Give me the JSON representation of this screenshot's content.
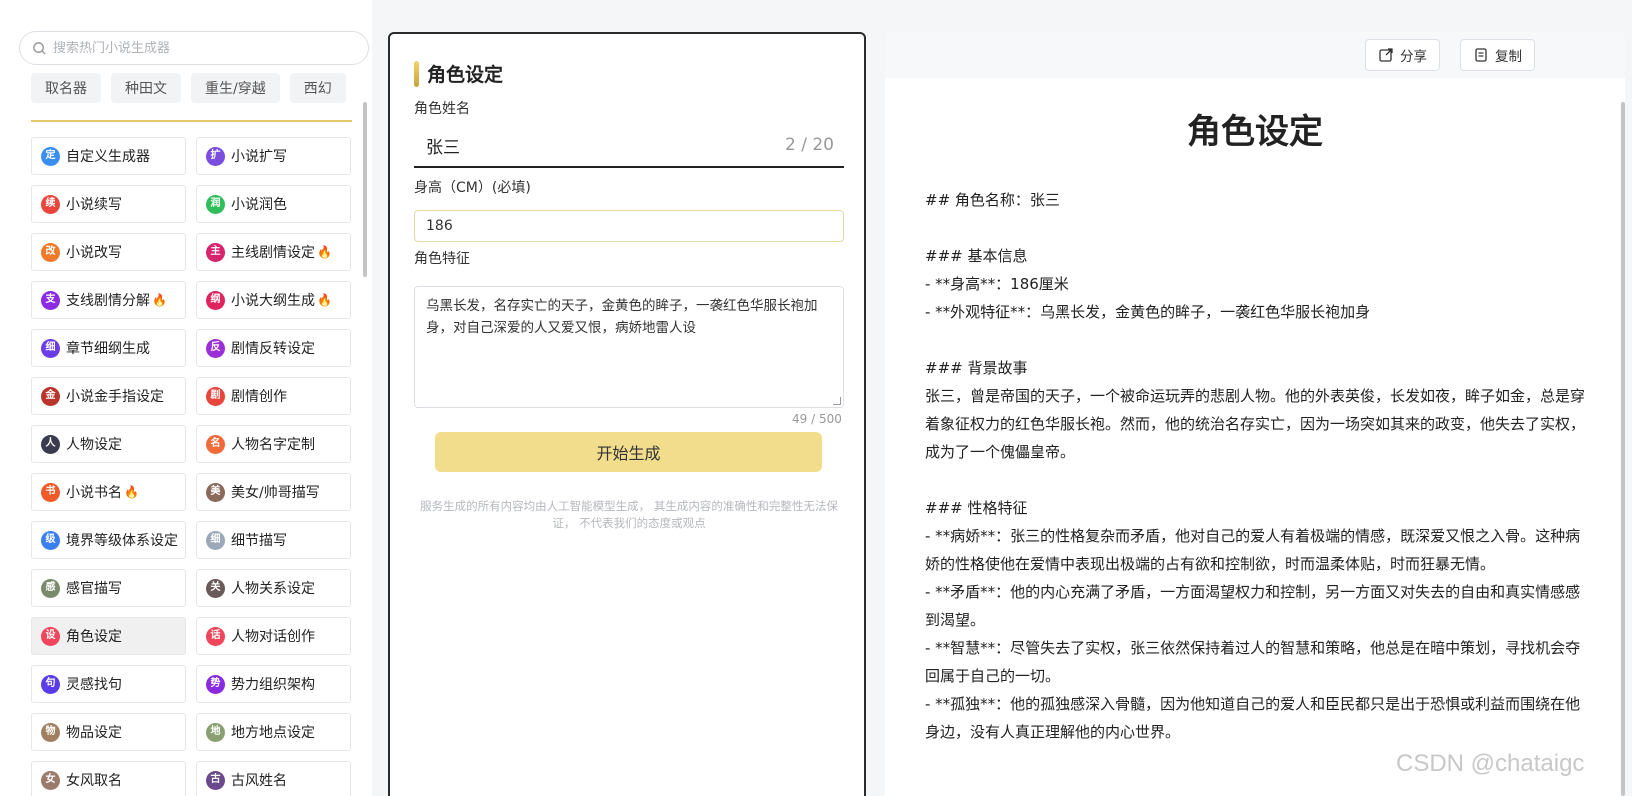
{
  "search": {
    "placeholder": "搜索热门小说生成器"
  },
  "categories": [
    "取名器",
    "种田文",
    "重生/穿越",
    "西幻"
  ],
  "tools": [
    {
      "label": "自定义生成器",
      "icon": "定",
      "color": "#3a8ef0",
      "hot": false,
      "active": false
    },
    {
      "label": "小说扩写",
      "icon": "扩",
      "color": "#7a4fe0",
      "hot": false,
      "active": false
    },
    {
      "label": "小说续写",
      "icon": "续",
      "color": "#e8453c",
      "hot": false,
      "active": false
    },
    {
      "label": "小说润色",
      "icon": "润",
      "color": "#2fbf5a",
      "hot": false,
      "active": false
    },
    {
      "label": "小说改写",
      "icon": "改",
      "color": "#f07a2a",
      "hot": false,
      "active": false
    },
    {
      "label": "主线剧情设定",
      "icon": "主",
      "color": "#d6246e",
      "hot": true,
      "active": false
    },
    {
      "label": "支线剧情分解",
      "icon": "支",
      "color": "#8a2be2",
      "hot": true,
      "active": false
    },
    {
      "label": "小说大纲生成",
      "icon": "纲",
      "color": "#e0245e",
      "hot": true,
      "active": false
    },
    {
      "label": "章节细纲生成",
      "icon": "细",
      "color": "#6a3de8",
      "hot": false,
      "active": false
    },
    {
      "label": "剧情反转设定",
      "icon": "反",
      "color": "#9b30d9",
      "hot": false,
      "active": false
    },
    {
      "label": "小说金手指设定",
      "icon": "金",
      "color": "#b8342c",
      "hot": false,
      "active": false
    },
    {
      "label": "剧情创作",
      "icon": "剧",
      "color": "#e8453c",
      "hot": false,
      "active": false
    },
    {
      "label": "人物设定",
      "icon": "人",
      "color": "#3b3b4f",
      "hot": false,
      "active": false
    },
    {
      "label": "人物名字定制",
      "icon": "名",
      "color": "#f06a3a",
      "hot": false,
      "active": false
    },
    {
      "label": "小说书名",
      "icon": "书",
      "color": "#f05a28",
      "hot": true,
      "active": false
    },
    {
      "label": "美女/帅哥描写",
      "icon": "美",
      "color": "#8a6a5a",
      "hot": false,
      "active": false
    },
    {
      "label": "境界等级体系设定",
      "icon": "级",
      "color": "#3a7ef0",
      "hot": false,
      "active": false
    },
    {
      "label": "细节描写",
      "icon": "细",
      "color": "#9aa8b8",
      "hot": false,
      "active": false
    },
    {
      "label": "感官描写",
      "icon": "感",
      "color": "#7a8a6a",
      "hot": false,
      "active": false
    },
    {
      "label": "人物关系设定",
      "icon": "关",
      "color": "#6a5a5a",
      "hot": false,
      "active": false
    },
    {
      "label": "角色设定",
      "icon": "设",
      "color": "#f0455a",
      "hot": false,
      "active": true
    },
    {
      "label": "人物对话创作",
      "icon": "话",
      "color": "#f0455a",
      "hot": false,
      "active": false
    },
    {
      "label": "灵感找句",
      "icon": "句",
      "color": "#5a3de8",
      "hot": false,
      "active": false
    },
    {
      "label": "势力组织架构",
      "icon": "势",
      "color": "#8a2be2",
      "hot": false,
      "active": false
    },
    {
      "label": "物品设定",
      "icon": "物",
      "color": "#a08060",
      "hot": false,
      "active": false
    },
    {
      "label": "地方地点设定",
      "icon": "地",
      "color": "#8aa070",
      "hot": false,
      "active": false
    },
    {
      "label": "女风取名",
      "icon": "女",
      "color": "#9a7a6a",
      "hot": false,
      "active": false
    },
    {
      "label": "古风姓名",
      "icon": "古",
      "color": "#6a4a8a",
      "hot": false,
      "active": false
    }
  ],
  "form": {
    "title": "角色设定",
    "name_label": "角色姓名",
    "name_value": "张三",
    "name_count": "2 / 20",
    "height_label": "身高（CM）(必填)",
    "height_value": "186",
    "trait_label": "角色特征",
    "trait_value": "乌黑长发，名存实亡的天子，金黄色的眸子，一袭红色华服长袍加身，对自己深爱的人又爱又恨，病娇地雷人设",
    "trait_count": "49 / 500",
    "start_label": "开始生成",
    "disclaimer": "服务生成的所有内容均由人工智能模型生成， 其生成内容的准确性和完整性无法保证， 不代表我们的态度或观点"
  },
  "result": {
    "share_label": "分享",
    "copy_label": "复制",
    "title": "角色设定",
    "lines": [
      "## 角色名称：张三",
      "",
      "### 基本信息",
      "- **身高**：186厘米",
      "- **外观特征**：乌黑长发，金黄色的眸子，一袭红色华服长袍加身",
      "",
      "### 背景故事",
      "张三，曾是帝国的天子，一个被命运玩弄的悲剧人物。他的外表英俊，长发如夜，眸子如金，总是穿着象征权力的红色华服长袍。然而，他的统治名存实亡，因为一场突如其来的政变，他失去了实权，成为了一个傀儡皇帝。",
      "",
      "### 性格特征",
      "- **病娇**：张三的性格复杂而矛盾，他对自己的爱人有着极端的情感，既深爱又恨之入骨。这种病娇的性格使他在爱情中表现出极端的占有欲和控制欲，时而温柔体贴，时而狂暴无情。",
      "- **矛盾**：他的内心充满了矛盾，一方面渴望权力和控制，另一方面又对失去的自由和真实情感感到渴望。",
      "- **智慧**：尽管失去了实权，张三依然保持着过人的智慧和策略，他总是在暗中策划，寻找机会夺回属于自己的一切。",
      "- **孤独**：他的孤独感深入骨髓，因为他知道自己的爱人和臣民都只是出于恐惧或利益而围绕在他身边，没有人真正理解他的内心世界。"
    ]
  },
  "watermark": "CSDN @chataigc",
  "colors": {
    "accent": "#e6c66a",
    "button": "#f1dd8c",
    "fire": "#ff7a1a"
  }
}
